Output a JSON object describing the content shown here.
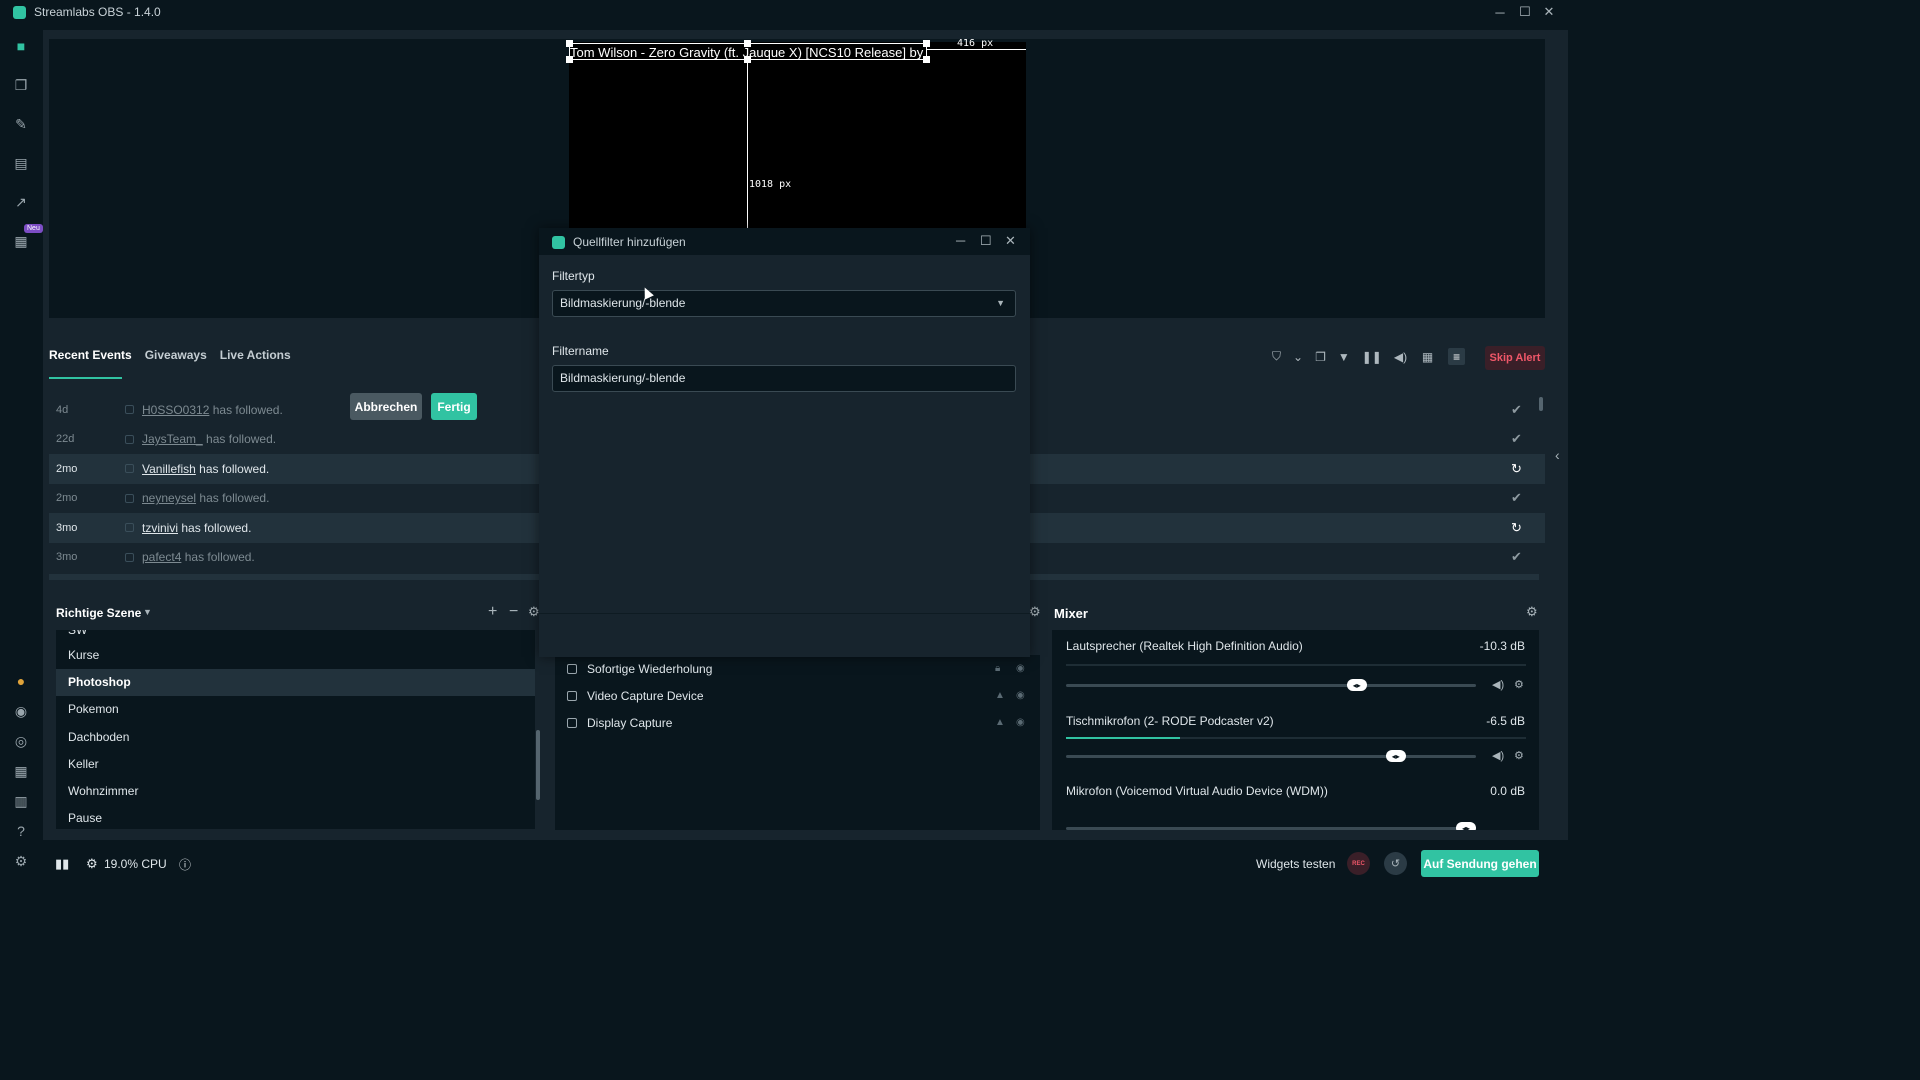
{
  "window": {
    "title": "Streamlabs OBS - 1.4.0"
  },
  "colors": {
    "accent": "#31c3a2",
    "background": "#09161d",
    "panel": "#17242d",
    "danger": "#f05769"
  },
  "sidebar": {
    "items": [
      {
        "name": "studio-icon"
      },
      {
        "name": "layouts-icon"
      },
      {
        "name": "themes-icon"
      },
      {
        "name": "store-icon"
      },
      {
        "name": "stats-icon"
      },
      {
        "name": "media-icon",
        "badge": "Neu"
      }
    ],
    "bottom_items": [
      {
        "name": "prime-icon"
      },
      {
        "name": "play-icon"
      },
      {
        "name": "chat-icon"
      },
      {
        "name": "grid-icon"
      },
      {
        "name": "library-icon"
      },
      {
        "name": "help-icon"
      },
      {
        "name": "settings-icon"
      }
    ]
  },
  "preview": {
    "source_text": "Tom Wilson - Zero Gravity (ft. Jauque X) [NCS10 Release] by",
    "measure_right": "416 px",
    "measure_bottom": "1018 px"
  },
  "events": {
    "tabs": [
      "Recent Events",
      "Giveaways",
      "Live Actions"
    ],
    "skip_label": "Skip Alert",
    "rows": [
      {
        "time": "4d",
        "user": "H0SSO0312",
        "action": "has followed.",
        "icon": "check"
      },
      {
        "time": "22d",
        "user": "JaysTeam_",
        "action": "has followed.",
        "icon": "check"
      },
      {
        "time": "2mo",
        "user": "Vanillefish",
        "action": "has followed.",
        "icon": "repeat"
      },
      {
        "time": "2mo",
        "user": "neyneysel",
        "action": "has followed.",
        "icon": "check"
      },
      {
        "time": "3mo",
        "user": "tzvinivi",
        "action": "has followed.",
        "icon": "repeat"
      },
      {
        "time": "3mo",
        "user": "pafect4",
        "action": "has followed.",
        "icon": "check"
      }
    ]
  },
  "scenes": {
    "header": "Richtige Szene",
    "partial_top": "SW",
    "items": [
      "Kurse",
      "Photoshop",
      "Pokemon",
      "Dachboden",
      "Keller",
      "Wohnzimmer",
      "Pause"
    ],
    "selected": "Photoshop"
  },
  "sources": {
    "items": [
      "Sofortige Wiederholung",
      "Video Capture Device",
      "Display Capture"
    ]
  },
  "mixer": {
    "header": "Mixer",
    "channels": [
      {
        "name": "Lautsprecher (Realtek High Definition Audio)",
        "db": "-10.3 dB",
        "level": 0.72
      },
      {
        "name": "Tischmikrofon (2- RODE Podcaster v2)",
        "db": "-6.5 dB",
        "level": 0.82
      },
      {
        "name": "Mikrofon (Voicemod Virtual Audio Device (WDM))",
        "db": "0.0 dB",
        "level": 1.0
      }
    ]
  },
  "footer": {
    "cpu": "19.0% CPU",
    "widgets": "Widgets testen",
    "rec": "REC",
    "golive": "Auf Sendung gehen"
  },
  "dialog": {
    "title": "Quellfilter hinzufügen",
    "filtertype_label": "Filtertyp",
    "filtertype_value": "Bildmaskierung/-blende",
    "filtername_label": "Filtername",
    "filtername_value": "Bildmaskierung/-blende",
    "cancel": "Abbrechen",
    "done": "Fertig"
  }
}
